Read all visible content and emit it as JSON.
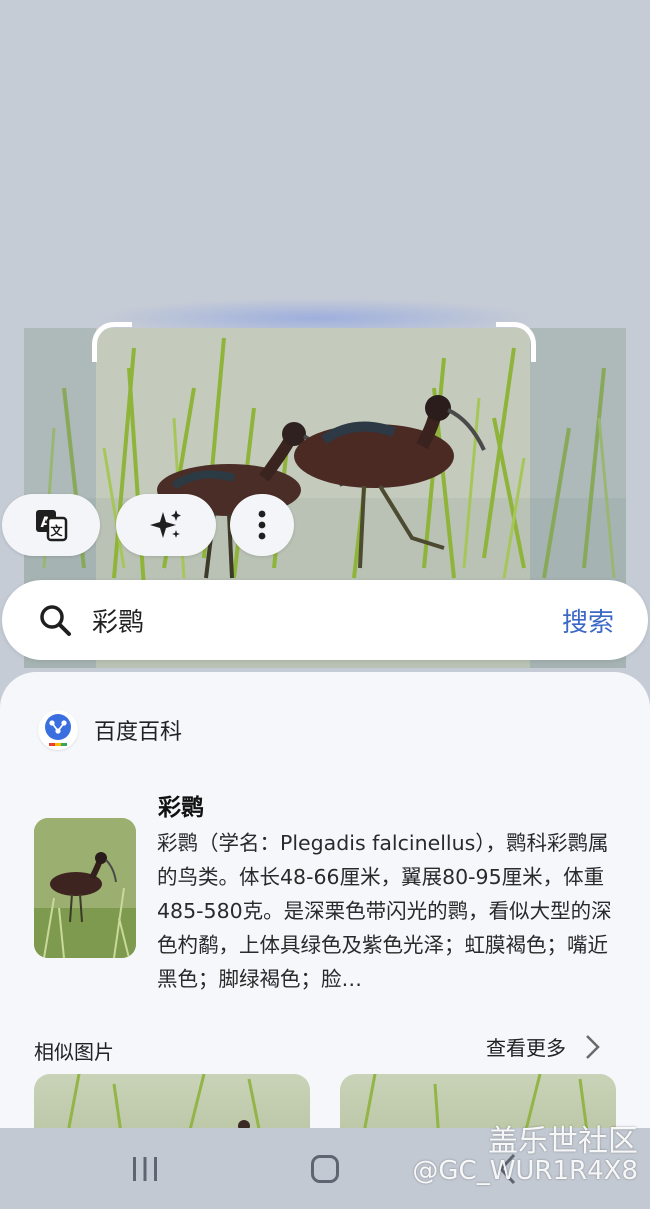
{
  "search": {
    "query": "彩鹮",
    "button_label": "搜索"
  },
  "chips": {
    "translate_icon": "translate-icon",
    "ai_icon": "sparkle-icon",
    "more_icon": "more-vert-icon"
  },
  "result": {
    "source": "百度百科",
    "title": "彩鹮",
    "description": "彩鹮（学名：Plegadis falcinellus），鹮科彩鹮属的鸟类。体长48-66厘米，翼展80-95厘米，体重485-580克。是深栗色带闪光的鹮，看似大型的深色杓鹬，上体具绿色及紫色光泽；虹膜褐色；嘴近黑色；脚绿褐色；脸…"
  },
  "similar": {
    "label": "相似图片",
    "see_more": "查看更多"
  },
  "watermark": {
    "brand": "盖乐世社区",
    "handle": "@GC_WUR1R4X8"
  },
  "colors": {
    "accent": "#3d69c6",
    "background": "#c6ccd6",
    "sheet": "#f6f7fb"
  }
}
